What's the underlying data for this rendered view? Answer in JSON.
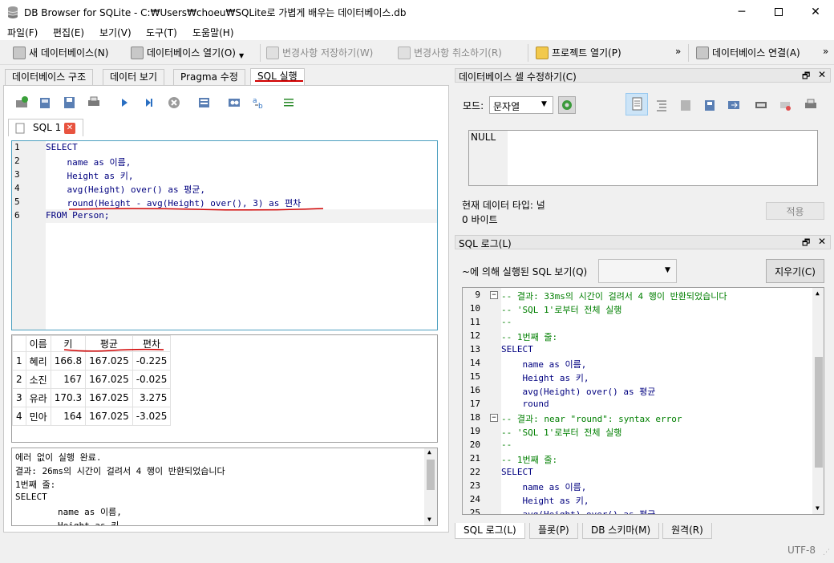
{
  "window": {
    "title": "DB Browser for SQLite - C:₩Users₩choeu₩SQLite로 가볍게 배우는 데이터베이스.db"
  },
  "menu": [
    "파일(F)",
    "편집(E)",
    "보기(V)",
    "도구(T)",
    "도움말(H)"
  ],
  "toolbar": {
    "new_db": "새 데이터베이스(N)",
    "open_db": "데이터베이스 열기(O)",
    "write_changes": "변경사항 저장하기(W)",
    "revert_changes": "변경사항 취소하기(R)",
    "open_project": "프로젝트 열기(P)",
    "attach_db": "데이터베이스 연결(A)",
    "more": "»"
  },
  "tabs": [
    "데이터베이스 구조",
    "데이터 보기",
    "Pragma 수정",
    "SQL 실행"
  ],
  "sql_tab": {
    "label": "SQL 1"
  },
  "editor": {
    "line_numbers": [
      "1",
      "2",
      "3",
      "4",
      "5",
      "6"
    ],
    "lines": [
      "SELECT",
      "    name as 이름,",
      "    Height as 키,",
      "    avg(Height) over() as 평균,",
      "    round(Height - avg(Height) over(), 3) as 편차",
      "FROM Person;"
    ]
  },
  "results": {
    "columns": [
      "이름",
      "키",
      "평균",
      "편차"
    ],
    "rows": [
      {
        "n": "1",
        "cells": [
          "혜리",
          "166.8",
          "167.025",
          "-0.225"
        ]
      },
      {
        "n": "2",
        "cells": [
          "소진",
          "167",
          "167.025",
          "-0.025"
        ]
      },
      {
        "n": "3",
        "cells": [
          "유라",
          "170.3",
          "167.025",
          "3.275"
        ]
      },
      {
        "n": "4",
        "cells": [
          "민아",
          "164",
          "167.025",
          "-3.025"
        ]
      }
    ]
  },
  "messages": [
    "에러 없이 실행 완료.",
    "결과: 26ms의 시간이 걸려서 4 행이 반환되었습니다",
    "1번째 줄:",
    "SELECT",
    "        name as 이름,",
    "        Height as 키"
  ],
  "cell_editor": {
    "title": "데이터베이스 셀 수정하기(C)",
    "mode_label": "모드:",
    "mode_value": "문자열",
    "value": "NULL",
    "type_text": "현재 데이터 타입: 널",
    "size_text": "0 바이트",
    "apply": "적용"
  },
  "sql_log": {
    "title": "SQL 로그(L)",
    "filter_label": "~에 의해 실행된 SQL 보기(Q)",
    "clear": "지우기(C)",
    "line_numbers": [
      "9",
      "10",
      "11",
      "12",
      "13",
      "14",
      "15",
      "16",
      "17",
      "18",
      "19",
      "20",
      "21",
      "22",
      "23",
      "24",
      "25"
    ],
    "lines": [
      "-- 결과: 33ms의 시간이 걸려서 4 행이 반환되었습니다",
      "-- 'SQL 1'로부터 전체 실행",
      "--",
      "-- 1번째 줄:",
      "SELECT",
      "    name as 이름,",
      "    Height as 키,",
      "    avg(Height) over() as 평균",
      "    round",
      "-- 결과: near \"round\": syntax error",
      "-- 'SQL 1'로부터 전체 실행",
      "--",
      "-- 1번째 줄:",
      "SELECT",
      "    name as 이름,",
      "    Height as 키,",
      "    avg(Height) over() as 평균,"
    ]
  },
  "bottom_tabs": [
    "SQL 로그(L)",
    "플롯(P)",
    "DB 스키마(M)",
    "원격(R)"
  ],
  "status": {
    "encoding": "UTF-8"
  },
  "colors": {
    "annotation": "#d00000",
    "editor_border": "#4c9fbf",
    "keyword": "#00007f",
    "comment": "#007f00"
  }
}
